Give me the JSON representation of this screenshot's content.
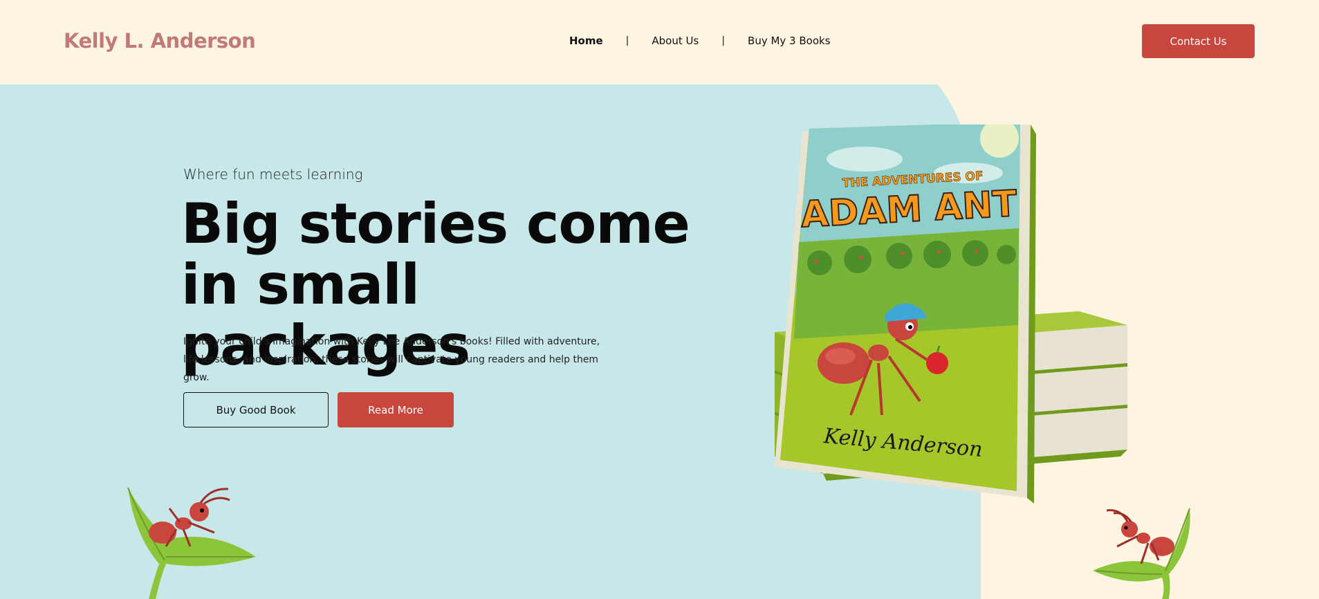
{
  "header": {
    "logo": "Kelly L. Anderson",
    "nav": [
      {
        "label": "Home",
        "active": true
      },
      {
        "label": "About Us",
        "active": false
      },
      {
        "label": "Buy My 3 Books",
        "active": false
      }
    ],
    "separator": "|",
    "contact_label": "Contact Us"
  },
  "hero": {
    "tagline": "Where fun meets learning",
    "headline_line1": "Big stories come",
    "headline_line2": "in small packages",
    "description": "Ignite your child's imagination with Kelly Lee Anderson's books! Filled with adventure, life lessons, and inspiration, these stories will captivate young readers and help them grow.",
    "buy_button": "Buy Good Book",
    "read_more_button": "Read More"
  },
  "book": {
    "title_top": "THE ADVENTURES OF",
    "title_main": "ADAM ANT",
    "author": "Kelly Anderson"
  },
  "colors": {
    "background": "#fdf5e2",
    "hero_bg": "#c7e7e8",
    "accent": "#c9463e",
    "logo": "#c27a76",
    "book_green": "#9bc22b"
  },
  "icons": [
    "ant-on-leaf-left",
    "ant-on-leaf-right",
    "book-stack"
  ]
}
